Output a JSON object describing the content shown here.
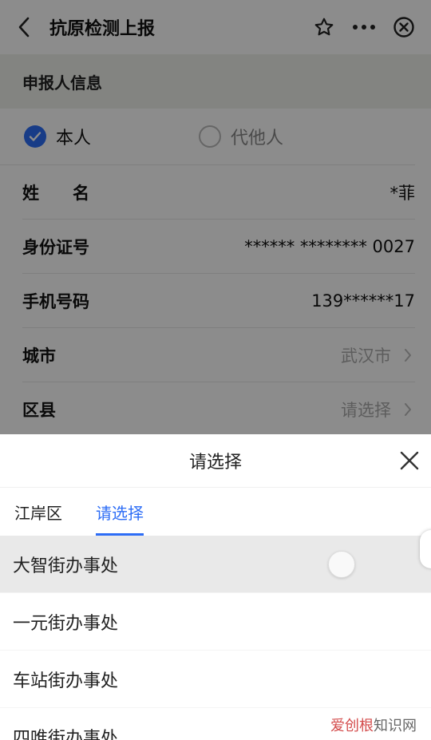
{
  "header": {
    "title": "抗原检测上报"
  },
  "section": {
    "title": "申报人信息"
  },
  "applicant": {
    "options": [
      "本人",
      "代他人"
    ],
    "selected": "本人"
  },
  "fields": [
    {
      "label": "姓　　名",
      "value": "*菲"
    },
    {
      "label": "身份证号",
      "value": "****** ******** 0027"
    },
    {
      "label": "手机号码",
      "value": "139******17"
    },
    {
      "label": "城市",
      "value": "武汉市"
    },
    {
      "label": "区县",
      "value": "请选择"
    }
  ],
  "picker": {
    "title": "请选择",
    "tabs": [
      "江岸区",
      "请选择"
    ],
    "active_tab": "请选择",
    "options": [
      "大智街办事处",
      "一元街办事处",
      "车站街办事处",
      "四唯街办事处"
    ],
    "highlighted": "大智街办事处"
  },
  "watermark": {
    "brand": "爱创根",
    "suffix": "知识网"
  },
  "colors": {
    "accent": "#2d6df6",
    "overlay": "rgba(0,0,0,0.45)"
  },
  "icons": [
    "back-icon",
    "star-icon",
    "more-icon",
    "close-circle-icon",
    "check-icon",
    "chevron-right-icon",
    "close-icon"
  ]
}
